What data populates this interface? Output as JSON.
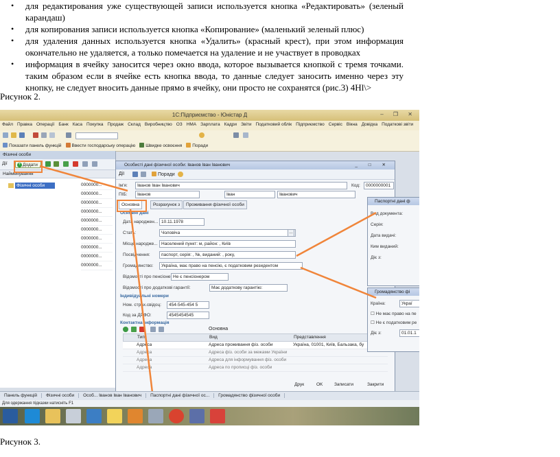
{
  "bullets": [
    "для редактирования уже существующей записи используется кнопка «Редактировать» (зеленый карандаш)",
    "для копирования записи используется кнопка «Копирование» (маленький зеленый плюс)",
    "для удаления данных используется кнопка «Удалить» (красный крест), при этом информация окончательно не удаляется, а только помечается на удаление и не участвует в проводках",
    "информация в ячейку заносится через окно ввода, которое вызывается кнопкой с тремя точками. таким образом если в ячейке есть кнопка ввода, то данные следует заносить именно через эту кнопку, не следует вносить данные прямо в ячейку, они просто не сохранятся (рис.3) 4Hl\\>"
  ],
  "bullet_glyph": "•",
  "caption_2": "Рисунок 2.",
  "caption_3": "Рисунок 3.",
  "screenshot": {
    "app_title": "1С:Підприємство - Юністар Д",
    "window_buttons": "– ❐ ✕",
    "menu": [
      "Файл",
      "Правка",
      "Операції",
      "Банк",
      "Каса",
      "Покупка",
      "Продаж",
      "Склад",
      "Виробництво",
      "ОЗ",
      "НМА",
      "Зарплата",
      "Кадри",
      "Звіти",
      "Податковий облік",
      "Підприємство",
      "Сервіс",
      "Вікна",
      "Довідка",
      "Податкові звіти"
    ],
    "toolbar2": [
      "Показати панель функцій",
      "Ввести господарську операцію",
      "Швидке освоєння",
      "Поради"
    ],
    "list_window": {
      "title": "Фізичні особи",
      "add_label": "Додати",
      "actions_label": "Дії",
      "column": "Найменування",
      "folder": "Фізичні особи",
      "codes": [
        "0000000...",
        "0000000...",
        "0000000...",
        "0000000...",
        "0000000...",
        "0000000...",
        "0000000...",
        "0000000...",
        "0000000...",
        "0000000..."
      ]
    },
    "person_window": {
      "title": "Особисті дані фізичної особи: Іванов Іван Іванович",
      "actions_label": "Дії",
      "tips_label": "Поради",
      "name_label": "Ім'я:",
      "name_value": "Іванов Іван Іванович",
      "code_label": "Код:",
      "code_value": "0000000001",
      "pib_label": "ПІБ:",
      "surname": "Іванов",
      "first_name": "Іван",
      "patronymic": "Іванович",
      "tabs": [
        "Основна",
        "Розрахунок з",
        "Проживання фізичної особи"
      ],
      "section_main": "Основні дані",
      "birth_label": "Дата народжен...",
      "birth_value": "10.11.1978",
      "sex_label": "Стать:",
      "sex_value": "Чоловіча",
      "birthplace_label": "Місце народже...",
      "birthplace_value": "Населений пункт: м, район: , Київ",
      "id_label": "Посвідчення:",
      "id_value": "паспорт, серія: , №, виданий: , року,",
      "citizen_label": "Громадянство:",
      "citizen_value": "Україна, має право на пенсію, є податковим резидентом",
      "pension_label": "Відомості про пенсіоне...",
      "pension_value": "Не є пенсіонером",
      "guarantee_label": "Відомості про додаткові гарантії:",
      "guarantee_value": "Має додаткову гарантію:",
      "section_ids": "Індивідуальні номери",
      "insurance_label": "Ном. страх.свідоц:",
      "insurance_value": "454-545-454 5",
      "drfo_label": "Код за ДРФО:",
      "drfo_value": "4545454545",
      "section_contacts": "Контактна інформація",
      "grid_tab": "Основна",
      "grid_headers": [
        "Тип",
        "Вид",
        "Представлення"
      ],
      "grid_rows": [
        [
          "Адреса",
          "Адреса проживання фіз. особи",
          "Україна, 01001, Київ, Бальзака, бу"
        ],
        [
          "Адреса",
          "Адреса фіз. особи за межами України",
          ""
        ],
        [
          "Адреса",
          "Адреса для інформування фіз. особи",
          ""
        ],
        [
          "Адреса",
          "Адреса по прописці фіз. особи",
          ""
        ]
      ],
      "print_label": "Друк",
      "ok_label": "OK",
      "save_label": "Записати",
      "close_label": "Закрити"
    },
    "passport_window": {
      "title": "Паспортні дані ф",
      "doc_label": "Вид документа:",
      "series_label": "Серія:",
      "date_label": "Дата видачі:",
      "issuer_label": "Ким виданий:",
      "from_label": "Діє з:"
    },
    "citizenship_window": {
      "title": "Громадянство фі",
      "country_label": "Країна:",
      "country_value": "Украї",
      "no_pension_label": "Не має право на пе",
      "not_resident_label": "Не є податковим ре",
      "from_label": "Діє з:",
      "from_value": "01.01.1"
    },
    "app_tabs": [
      "Панель функцій",
      "Фізичні особи",
      "Особ... Іванов Іван Іванович",
      "Паспортні дані фізичної ос...",
      "Громадянство фізичної особи"
    ],
    "status_text": "Для одержання підказки натисніть F1"
  }
}
